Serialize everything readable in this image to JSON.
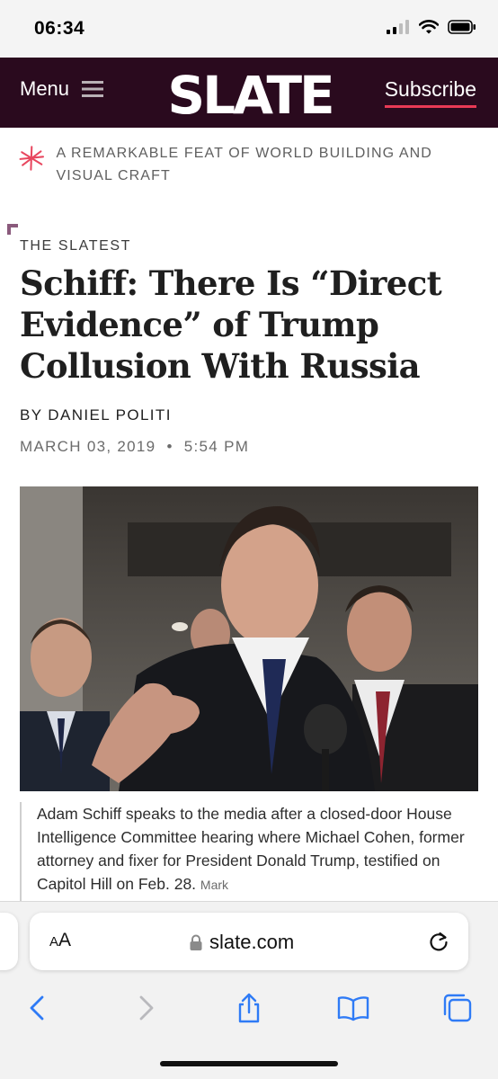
{
  "status_bar": {
    "time": "06:34",
    "icons": [
      "cellular-signal-icon",
      "wifi-icon",
      "battery-icon"
    ]
  },
  "site_header": {
    "menu_label": "Menu",
    "logo_text": "SLATE",
    "subscribe_label": "Subscribe",
    "colors": {
      "background": "#2a0a1e",
      "accent": "#e83a55"
    }
  },
  "promo": {
    "icon": "slate-burst-icon",
    "text": "A Remarkable Feat of World Building and Visual Craft"
  },
  "article": {
    "kicker": "THE SLATEST",
    "headline": "Schiff: There Is “Direct Evidence” of Trump Collusion With Russia",
    "byline": "BY DANIEL POLITI",
    "date": "MARCH 03, 2019",
    "separator": "•",
    "time": "5:54 PM",
    "caption": "Adam Schiff speaks to the media after a closed-door House Intelligence Committee hearing where Michael Cohen, former attorney and fixer for President Donald Trump, testified on Capitol Hill on Feb. 28.",
    "credit": "Mark"
  },
  "browser": {
    "text_size_small": "A",
    "text_size_large": "A",
    "url": "slate.com",
    "toolbar": [
      "back-icon",
      "forward-icon",
      "share-icon",
      "bookmarks-icon",
      "tabs-icon"
    ]
  }
}
